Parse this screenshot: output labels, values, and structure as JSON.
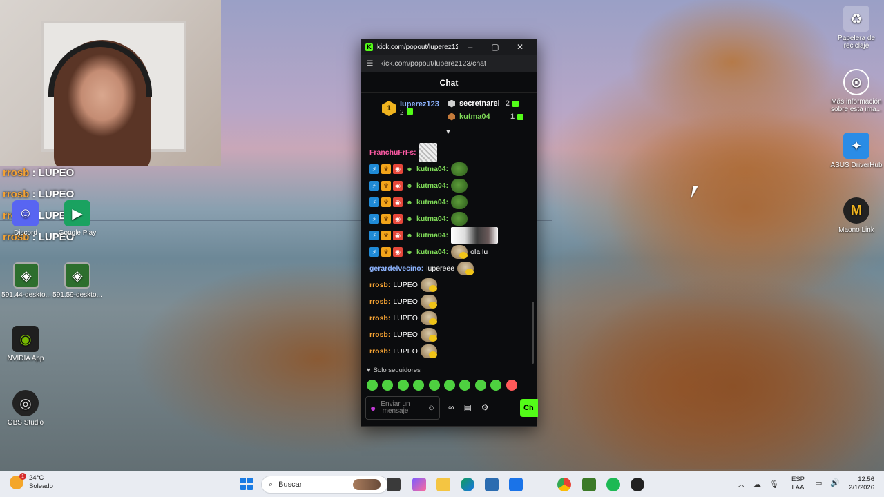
{
  "desktop": {
    "icons_left": [
      {
        "label": "Discord",
        "icon": "discord-icon"
      },
      {
        "label": "Google Play",
        "icon": "google-play-icon"
      },
      {
        "label": "591.44-deskto...",
        "icon": "nvidia-installer-icon"
      },
      {
        "label": "591.59-deskto...",
        "icon": "nvidia-installer-icon"
      },
      {
        "label": "NVIDIA App",
        "icon": "nvidia-icon"
      },
      {
        "label": "OBS Studio",
        "icon": "obs-icon"
      }
    ],
    "icons_right": [
      {
        "label": "Papelera de reciclaje",
        "icon": "recycle-bin-icon"
      },
      {
        "label": "Más información sobre esta ima...",
        "icon": "info-camera-icon"
      },
      {
        "label": "ASUS DriverHub",
        "icon": "asus-icon"
      },
      {
        "label": "Maono Link",
        "icon": "maono-icon"
      }
    ],
    "overlay_messages": [
      {
        "user": "rrosb",
        "text": " : LUPEO"
      },
      {
        "user": "rrosb",
        "text": " : LUPEO"
      },
      {
        "user": "rrosb",
        "text": " : LUPEO"
      },
      {
        "user": "rrosb",
        "text": " : LUPEO"
      }
    ]
  },
  "popout": {
    "window_title": "kick.com/popout/luperez12...",
    "url": "kick.com/popout/luperez123/chat",
    "chat_title": "Chat",
    "leaderboard": {
      "first": {
        "rank": "1",
        "name": "luperez123",
        "count": "2"
      },
      "second": {
        "name": "secretnarel",
        "count": "2"
      },
      "third": {
        "name": "kutma04",
        "count": "1"
      }
    },
    "messages": [
      {
        "user": "FranchuFrFs",
        "user_color": "#ff5aa5",
        "text": "",
        "badges": false,
        "emote": "meme"
      },
      {
        "user": "kutma04",
        "user_color": "#7ed957",
        "text": "",
        "badges": true,
        "emote": "pepe"
      },
      {
        "user": "kutma04",
        "user_color": "#7ed957",
        "text": "",
        "badges": true,
        "emote": "pepe"
      },
      {
        "user": "kutma04",
        "user_color": "#7ed957",
        "text": "",
        "badges": true,
        "emote": "pepe"
      },
      {
        "user": "kutma04",
        "user_color": "#7ed957",
        "text": "",
        "badges": true,
        "emote": "pepe"
      },
      {
        "user": "kutma04",
        "user_color": "#7ed957",
        "text": "",
        "badges": true,
        "emote": "photo"
      },
      {
        "user": "kutma04",
        "user_color": "#7ed957",
        "text": "ola lu",
        "badges": true,
        "emote": "cat"
      },
      {
        "user": "gerardelvecino",
        "user_color": "#8db4ff",
        "text": "lupereee",
        "badges": false,
        "emote": "cat"
      },
      {
        "user": "rrosb",
        "user_color": "#f4a233",
        "text": "LUPEO",
        "badges": false,
        "emote": "cat"
      },
      {
        "user": "rrosb",
        "user_color": "#f4a233",
        "text": "LUPEO",
        "badges": false,
        "emote": "cat"
      },
      {
        "user": "rrosb",
        "user_color": "#f4a233",
        "text": "LUPEO",
        "badges": false,
        "emote": "cat"
      },
      {
        "user": "rrosb",
        "user_color": "#f4a233",
        "text": "LUPEO",
        "badges": false,
        "emote": "cat"
      },
      {
        "user": "rrosb",
        "user_color": "#f4a233",
        "text": "LUPEO",
        "badges": false,
        "emote": "cat"
      }
    ],
    "followers_only": "Solo seguidores",
    "composer_placeholder": "Enviar un mensaje",
    "send_label": "Ch",
    "accent": "#53fc18"
  },
  "taskbar": {
    "weather_temp": "24°C",
    "weather_desc": "Soleado",
    "notification_count": "1",
    "search_placeholder": "Buscar",
    "lang_top": "ESP",
    "lang_bottom": "LAA",
    "time": "12:56",
    "date": "2/1/2026"
  }
}
